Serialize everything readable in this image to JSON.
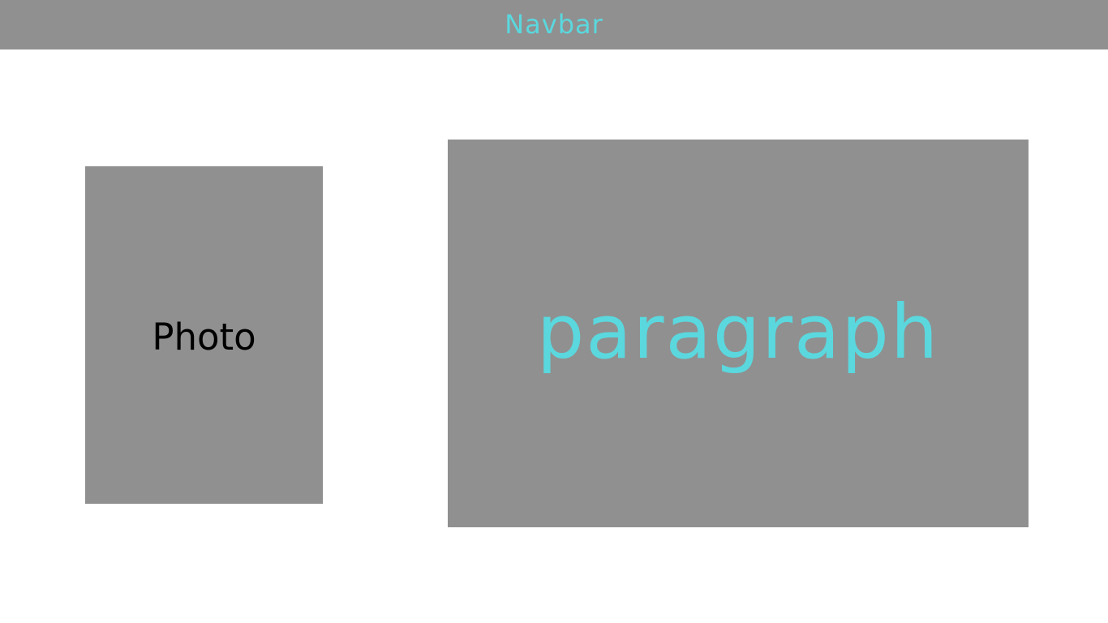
{
  "navbar": {
    "title": "Navbar"
  },
  "photo": {
    "label": "Photo"
  },
  "content": {
    "paragraph": "paragraph"
  },
  "colors": {
    "block_gray": "#909090",
    "accent_cyan": "#5ad8de",
    "background": "#ffffff",
    "photo_text": "#000000"
  }
}
